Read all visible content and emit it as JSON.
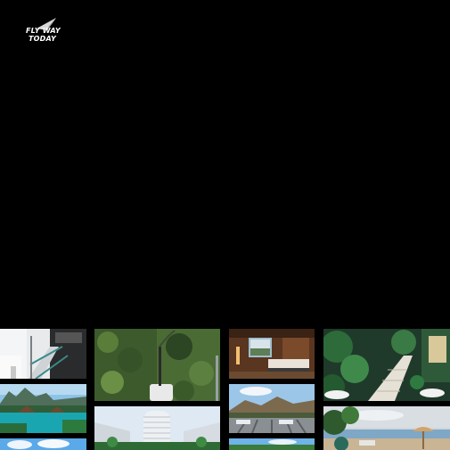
{
  "brand": {
    "line1": "FLY WAY",
    "line2": "TODAY"
  },
  "gallery": {
    "photos": [
      "staircase-photo",
      "lagoon-resort-photo",
      "beach-clouds-photo",
      "vertical-garden-photo",
      "hotel-tower-photo",
      "hotel-room-photo",
      "mountain-terrace-photo",
      "sea-terrace-photo",
      "tropical-courtyard-photo",
      "beach-umbrella-photo"
    ]
  },
  "colors": {
    "background": "#000000",
    "logo": "#ffffff",
    "logo_accent": "#bfbfbf"
  }
}
